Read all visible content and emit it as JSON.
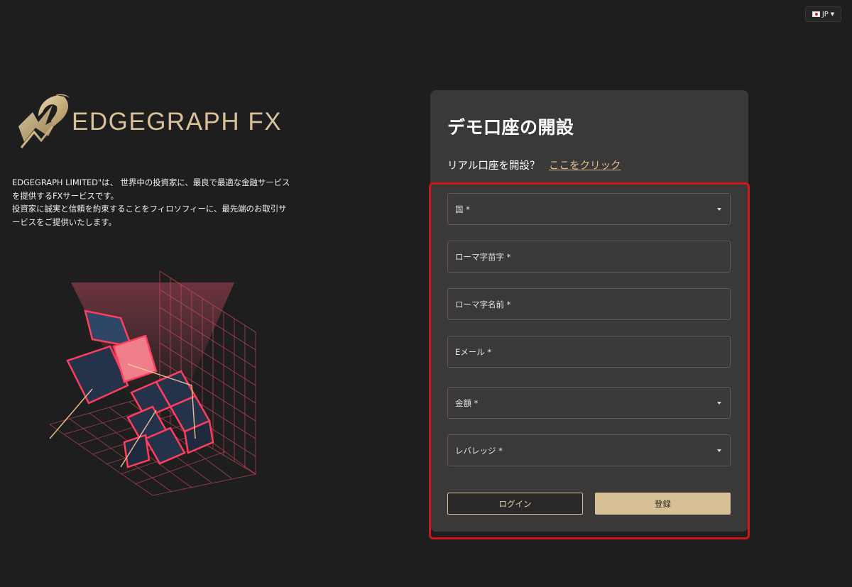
{
  "header": {
    "language": "JP"
  },
  "brand": {
    "name": "EDGEGRAPH FX"
  },
  "intro": {
    "line1": "EDGEGRAPH LIMITED\"は、 世界中の投資家に、最良で最適な金融サービス",
    "line2": "を提供するFXサービスです。",
    "line3": "投資家に誠実と信頼を約束することをフィロソフィーに、最先端のお取引サ",
    "line4": "ービスをご提供いたします。"
  },
  "form": {
    "title": "デモ口座の開設",
    "real_prompt": "リアル口座を開設？",
    "real_link": "ここをクリック",
    "fields": [
      {
        "label": "国 *",
        "type": "select"
      },
      {
        "label": "ローマ字苗字 *",
        "type": "text"
      },
      {
        "label": "ローマ字名前 *",
        "type": "text"
      },
      {
        "label": "Eメール *",
        "type": "text"
      },
      {
        "label": "金額 *",
        "type": "select"
      },
      {
        "label": "レバレッジ *",
        "type": "select"
      }
    ],
    "login_label": "ログイン",
    "register_label": "登録"
  },
  "colors": {
    "background": "#1f1e1e",
    "card": "#3b3838",
    "accent_gold": "#d7c096",
    "highlight_red": "#d2141b",
    "illustration_pink": "#ff4d6a"
  }
}
